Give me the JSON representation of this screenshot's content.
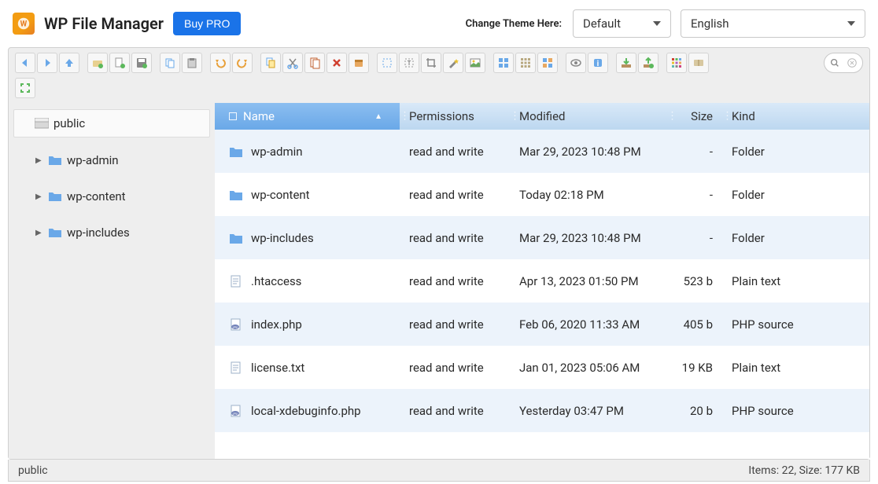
{
  "header": {
    "title": "WP File Manager",
    "buy_pro": "Buy PRO",
    "theme_label": "Change Theme Here:",
    "theme_value": "Default",
    "lang_value": "English"
  },
  "columns": {
    "name": "Name",
    "perm": "Permissions",
    "mod": "Modified",
    "size": "Size",
    "kind": "Kind"
  },
  "tree": {
    "root": "public",
    "children": [
      "wp-admin",
      "wp-content",
      "wp-includes"
    ]
  },
  "files": [
    {
      "icon": "folder",
      "name": "wp-admin",
      "perm": "read and write",
      "mod": "Mar 29, 2023 10:48 PM",
      "size": "-",
      "kind": "Folder"
    },
    {
      "icon": "folder",
      "name": "wp-content",
      "perm": "read and write",
      "mod": "Today 02:18 PM",
      "size": "-",
      "kind": "Folder"
    },
    {
      "icon": "folder",
      "name": "wp-includes",
      "perm": "read and write",
      "mod": "Mar 29, 2023 10:48 PM",
      "size": "-",
      "kind": "Folder"
    },
    {
      "icon": "text",
      "name": ".htaccess",
      "perm": "read and write",
      "mod": "Apr 13, 2023 01:50 PM",
      "size": "523 b",
      "kind": "Plain text"
    },
    {
      "icon": "php",
      "name": "index.php",
      "perm": "read and write",
      "mod": "Feb 06, 2020 11:33 AM",
      "size": "405 b",
      "kind": "PHP source"
    },
    {
      "icon": "text",
      "name": "license.txt",
      "perm": "read and write",
      "mod": "Jan 01, 2023 05:06 AM",
      "size": "19 KB",
      "kind": "Plain text"
    },
    {
      "icon": "php",
      "name": "local-xdebuginfo.php",
      "perm": "read and write",
      "mod": "Yesterday 03:47 PM",
      "size": "20 b",
      "kind": "PHP source"
    }
  ],
  "status": {
    "path": "public",
    "summary": "Items: 22, Size: 177 KB"
  },
  "toolbar_icons": [
    [
      "back",
      "forward",
      "up"
    ],
    [
      "new-folder",
      "new-file",
      "save"
    ],
    [
      "copy",
      "paste"
    ],
    [
      "undo",
      "redo"
    ],
    [
      "duplicate",
      "cut",
      "copy-2",
      "delete",
      "zip"
    ],
    [
      "select",
      "text-select",
      "crop",
      "magic",
      "image"
    ],
    [
      "grid-large",
      "grid-small",
      "grid-columns"
    ],
    [
      "preview",
      "info"
    ],
    [
      "download",
      "upload"
    ],
    [
      "theme",
      "help"
    ]
  ]
}
